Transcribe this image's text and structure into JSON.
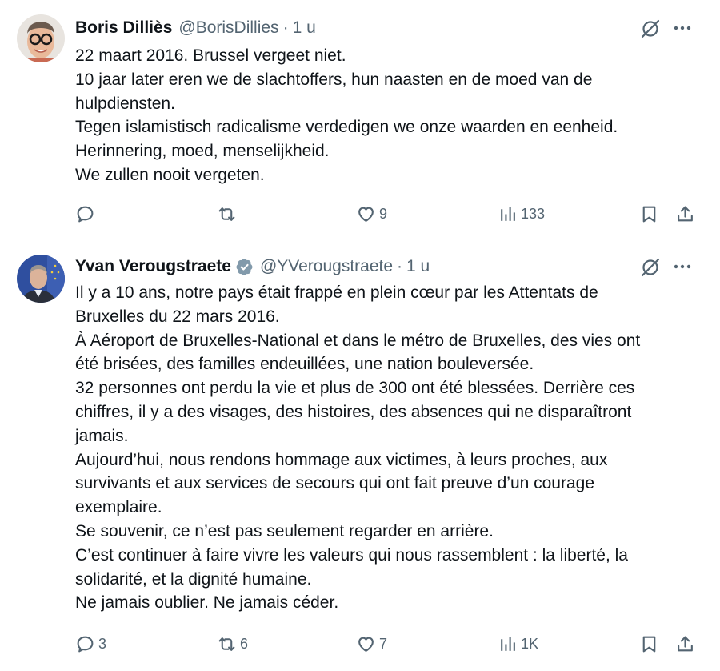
{
  "tweets": [
    {
      "display_name": "Boris Dilliès",
      "handle": "@BorisDillies",
      "separator": "·",
      "time": "1 u",
      "verified": false,
      "lines": [
        "22 maart 2016. Brussel vergeet niet.",
        "10 jaar later eren we de slachtoffers, hun naasten en de moed van de",
        "hulpdiensten.",
        "Tegen islamistisch radicalisme verdedigen we onze waarden en eenheid.",
        "Herinnering, moed, menselijkheid.",
        "We zullen nooit vergeten."
      ],
      "actions": {
        "replies": "",
        "reposts": "",
        "likes": "9",
        "views": "133"
      }
    },
    {
      "display_name": "Yvan Verougstraete",
      "handle": "@YVerougstraete",
      "separator": "·",
      "time": "1 u",
      "verified": true,
      "lines": [
        "Il y a 10 ans, notre pays était frappé en plein cœur par les Attentats de",
        "Bruxelles du 22 mars 2016.",
        "À Aéroport de Bruxelles-National et dans le métro de Bruxelles, des vies ont",
        "été brisées, des familles endeuillées, une nation bouleversée.",
        "32 personnes ont perdu la vie et plus de 300 ont été blessées. Derrière ces",
        "chiffres, il y a des visages, des histoires, des absences qui ne disparaîtront",
        "jamais.",
        "Aujourd’hui, nous rendons hommage aux victimes, à leurs proches, aux",
        "survivants et aux services de secours qui ont fait preuve d’un courage",
        "exemplaire.",
        "Se souvenir, ce n’est pas seulement regarder en arrière.",
        "C’est continuer à faire vivre les valeurs qui nous rassemblent : la liberté, la",
        "solidarité, et la dignité humaine.",
        "Ne jamais oublier. Ne jamais céder."
      ],
      "actions": {
        "replies": "3",
        "reposts": "6",
        "likes": "7",
        "views": "1K"
      }
    }
  ],
  "icons": {
    "reply": "reply-icon",
    "repost": "repost-icon",
    "like": "like-icon",
    "views": "views-icon",
    "bookmark": "bookmark-icon",
    "share": "share-icon",
    "grok": "grok-icon",
    "more": "more-icon",
    "verified": "verified-badge-icon"
  },
  "colors": {
    "text_primary": "#0f1419",
    "text_secondary": "#536471",
    "verified_badge": "#829aab",
    "divider": "#eff3f4"
  }
}
